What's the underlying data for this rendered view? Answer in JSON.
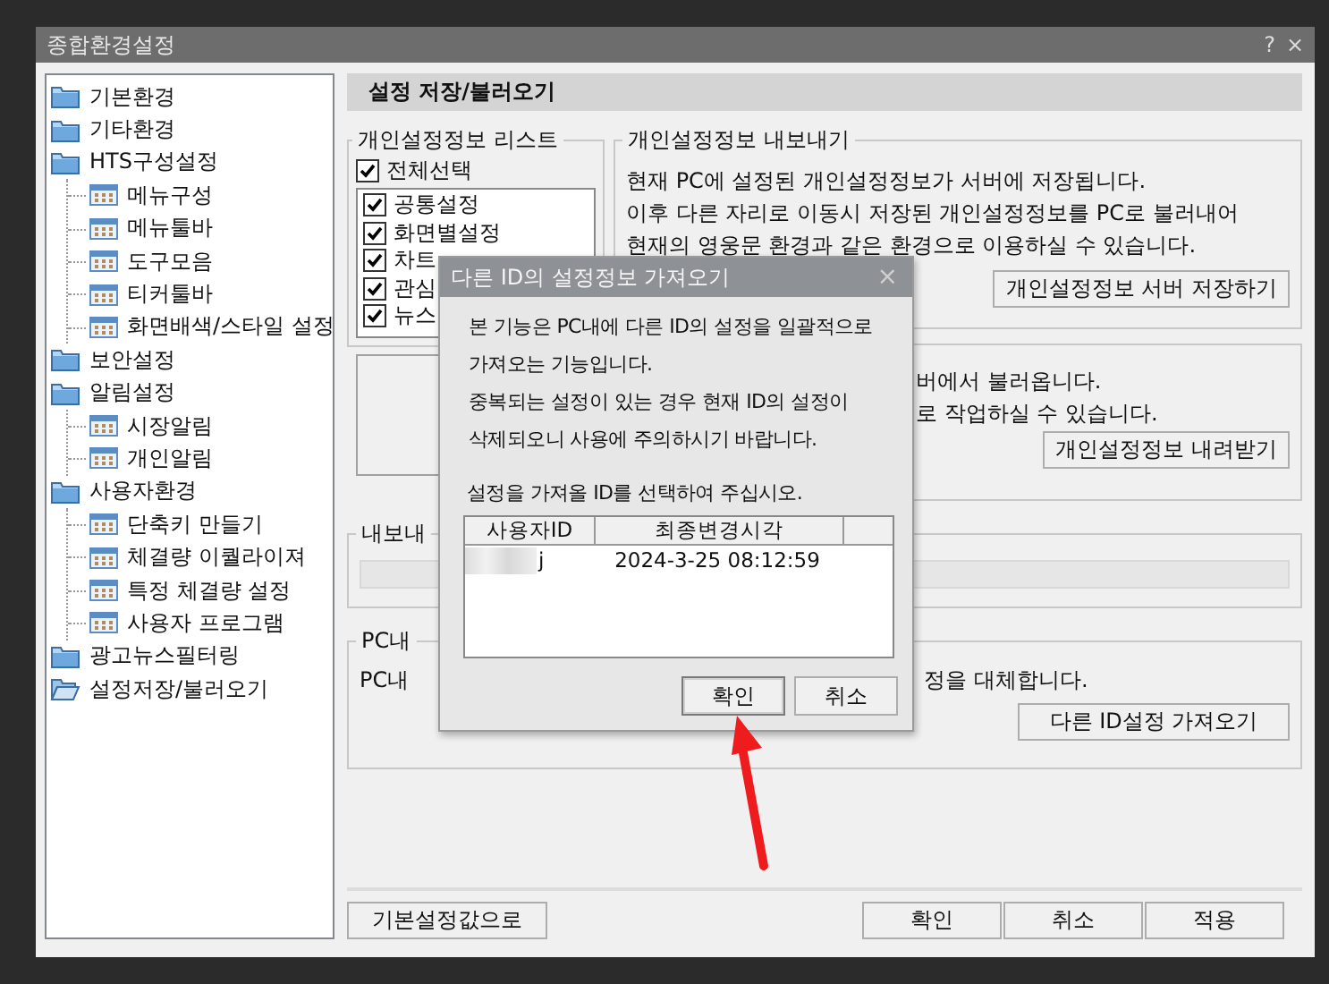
{
  "window": {
    "title": "종합환경설정",
    "help": "?",
    "close": "×"
  },
  "tree": [
    {
      "label": "기본환경",
      "selected": false
    },
    {
      "label": "기타환경",
      "selected": false
    },
    {
      "label": "HTS구성설정",
      "selected": false,
      "children": [
        {
          "label": "메뉴구성"
        },
        {
          "label": "메뉴툴바"
        },
        {
          "label": "도구모음"
        },
        {
          "label": "티커툴바"
        },
        {
          "label": "화면배색/스타일 설정"
        }
      ]
    },
    {
      "label": "보안설정",
      "selected": false
    },
    {
      "label": "알림설정",
      "selected": false,
      "children": [
        {
          "label": "시장알림"
        },
        {
          "label": "개인알림"
        }
      ]
    },
    {
      "label": "사용자환경",
      "selected": false,
      "children": [
        {
          "label": "단축키 만들기"
        },
        {
          "label": "체결량 이퀄라이져"
        },
        {
          "label": "특정 체결량 설정"
        },
        {
          "label": "사용자 프로그램"
        }
      ]
    },
    {
      "label": "광고뉴스필터링",
      "selected": false
    },
    {
      "label": "설정저장/불러오기",
      "selected": true
    }
  ],
  "section_title": "설정 저장/불러오기",
  "list_group": {
    "title": "개인설정정보 리스트",
    "select_all": {
      "label": "전체선택",
      "checked": true
    },
    "items": [
      {
        "label": "공통설정",
        "checked": true
      },
      {
        "label": "화면별설정",
        "checked": true
      },
      {
        "label": "차트",
        "checked": true
      },
      {
        "label": "관심",
        "checked": true
      },
      {
        "label": "뉴스",
        "checked": true
      }
    ]
  },
  "export_group": {
    "title": "개인설정정보 내보내기",
    "lines": [
      "현재 PC에 설정된 개인설정정보가 서버에 저장됩니다.",
      "이후 다른 자리로 이동시 저장된 개인설정정보를 PC로 불러내어",
      "현재의 영웅문 환경과 같은 환경으로 이용하실 수 있습니다."
    ],
    "button": "개인설정정보 서버 저장하기"
  },
  "download_group": {
    "lines": [
      "버에서 불러옵니다.",
      "로 작업하실 수 있습니다."
    ],
    "button": "개인설정정보 내려받기"
  },
  "progress_group": {
    "title": "내보내",
    "level": 0
  },
  "pc_group": {
    "title": "PC내",
    "left_text": "PC내",
    "right_text": "정을 대체합니다.",
    "button": "다른 ID설정 가져오기"
  },
  "footer": {
    "defaults_button": "기본설정값으로",
    "buttons": [
      "확인",
      "취소",
      "적용"
    ]
  },
  "dialog": {
    "title": "다른 ID의 설정정보 가져오기",
    "close": "×",
    "lines": [
      "본 기능은 PC내에 다른 ID의 설정을 일괄적으로",
      "가져오는 기능입니다.",
      "중복되는 설정이 있는 경우 현재 ID의 설정이",
      "삭제되오니 사용에 주의하시기 바랍니다."
    ],
    "prompt": "설정을 가져올 ID를 선택하여 주십시오.",
    "table": {
      "columns": [
        "사용자ID",
        "최종변경시각"
      ],
      "rows": [
        {
          "user": "j",
          "time": "2024-3-25 08:12:59",
          "selected": false
        }
      ]
    },
    "buttons": [
      {
        "label": "확인",
        "focused": true
      },
      {
        "label": "취소",
        "focused": false
      }
    ]
  }
}
